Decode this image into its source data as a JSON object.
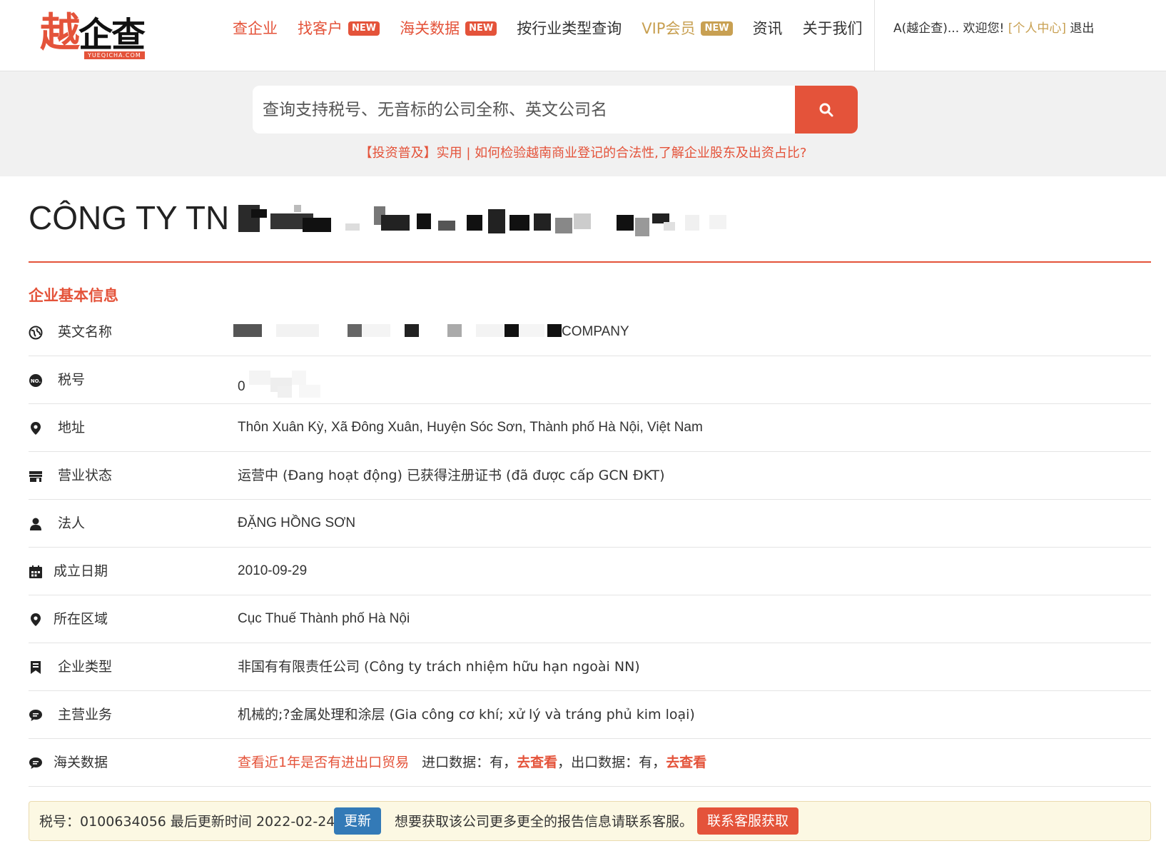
{
  "header": {
    "logo_text": "越企查",
    "logo_sub": "YUEQICHA.COM",
    "nav": [
      {
        "label": "查企业",
        "badge": ""
      },
      {
        "label": "找客户",
        "badge": "NEW"
      },
      {
        "label": "海关数据",
        "badge": "NEW"
      },
      {
        "label": "按行业类型查询",
        "badge": ""
      },
      {
        "label": "VIP会员",
        "badge": "NEW"
      },
      {
        "label": "资讯",
        "badge": ""
      },
      {
        "label": "关于我们",
        "badge": ""
      }
    ],
    "user_greeting": "A(越企查)... 欢迎您!",
    "user_center": "[个人中心]",
    "logout": "退出"
  },
  "search": {
    "placeholder": "查询支持税号、无音标的公司全称、英文公司名",
    "tip": "【投资普及】实用 | 如何检验越南商业登记的合法性,了解企业股东及出资占比?"
  },
  "company": {
    "title_prefix": "CÔNG TY TN"
  },
  "section": {
    "title": "企业基本信息"
  },
  "info_rows": [
    {
      "label": "英文名称",
      "value": "COMPANY"
    },
    {
      "label": "税号",
      "value": "0"
    },
    {
      "label": "地址",
      "value": "Thôn Xuân Kỳ, Xã Đông Xuân, Huyện Sóc Sơn, Thành phố Hà Nội, Việt Nam"
    },
    {
      "label": "营业状态",
      "value": "运营中 (Đang hoạt động) 已获得注册证书 (đã được cấp GCN ĐKT)"
    },
    {
      "label": "法人",
      "value": "ĐẶNG HỒNG SƠN"
    },
    {
      "label": "成立日期",
      "value": "2010-09-29"
    },
    {
      "label": "所在区域",
      "value": "Cục Thuế Thành phố Hà Nội"
    },
    {
      "label": "企业类型",
      "value": "非国有有限责任公司 (Công ty trách nhiệm hữu hạn ngoài NN)"
    },
    {
      "label": "主营业务",
      "value": "机械的;?金属处理和涂层 (Gia công cơ khí; xử lý và tráng phủ kim loại)"
    },
    {
      "label": "海关数据",
      "value": ""
    }
  ],
  "customs": {
    "check_link": "查看近1年是否有进出口贸易",
    "import_label": "进口数据：有，",
    "import_link": "去查看",
    "export_label": "，出口数据：有，",
    "export_link": "去查看"
  },
  "notice": {
    "tax_text": "税号：0100634056 最后更新时间 2022-02-24",
    "update_btn": "更新",
    "contact_text": "想要获取该公司更多更全的报告信息请联系客服。",
    "contact_btn": "联系客服获取"
  },
  "colors": {
    "accent": "#e4533a",
    "gold": "#c8a052",
    "blue": "#337ab7"
  }
}
